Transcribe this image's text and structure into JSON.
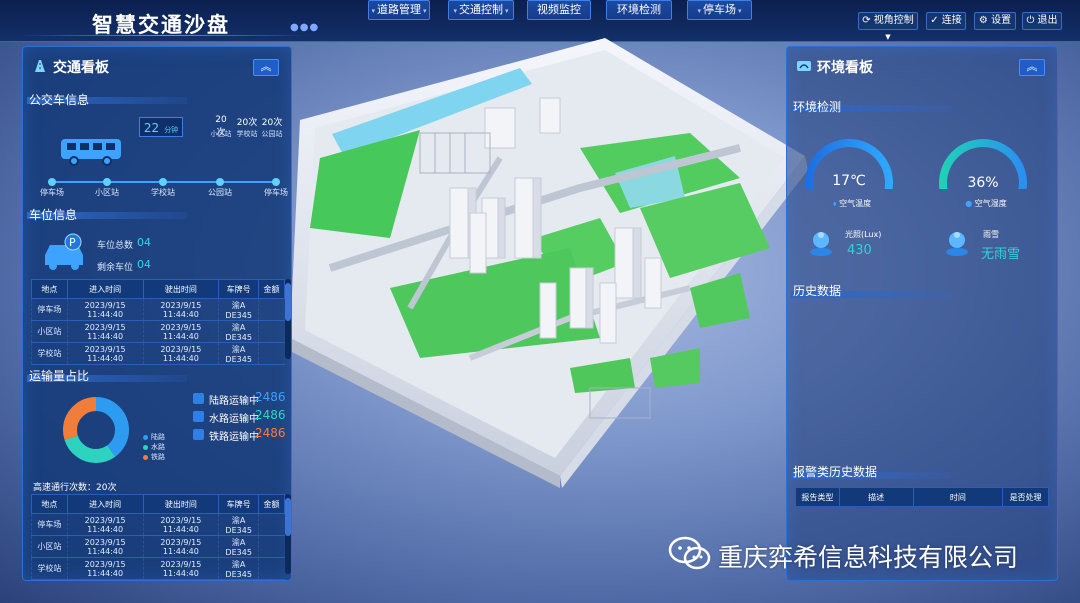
{
  "app_title": "智慧交通沙盘",
  "nav": [
    {
      "label": "道路管理",
      "dropdown": true
    },
    {
      "label": "交通控制",
      "dropdown": true
    },
    {
      "label": "视频监控",
      "dropdown": false
    },
    {
      "label": "环境检测",
      "dropdown": false
    },
    {
      "label": "停车场",
      "dropdown": true
    }
  ],
  "toolbar": {
    "view_control": "视角控制",
    "connect": "连接",
    "settings": "设置",
    "logout": "退出"
  },
  "left_panel": {
    "title": "交通看板",
    "bus": {
      "section": "公交车信息",
      "eta_value": "22",
      "eta_unit": "分钟",
      "counts": [
        {
          "value": "20次",
          "stop": "小区站"
        },
        {
          "value": "20次",
          "stop": "学校站"
        },
        {
          "value": "20次",
          "stop": "公园站"
        }
      ],
      "route": [
        "停车场",
        "小区站",
        "学校站",
        "公园站",
        "停车场"
      ]
    },
    "parking": {
      "section": "车位信息",
      "total_label": "车位总数",
      "total_value": "04",
      "remain_label": "剩余车位",
      "remain_value": "04",
      "table": {
        "headers": [
          "地点",
          "进入时间",
          "驶出时间",
          "车牌号",
          "金额"
        ],
        "rows": [
          [
            "停车场",
            "2023/9/15 11:44:40",
            "2023/9/15 11:44:40",
            "渝A DE345",
            ""
          ],
          [
            "小区站",
            "2023/9/15 11:44:40",
            "2023/9/15 11:44:40",
            "渝A DE345",
            ""
          ],
          [
            "学校站",
            "2023/9/15 11:44:40",
            "2023/9/15 11:44:40",
            "渝A DE345",
            ""
          ]
        ]
      }
    },
    "transport": {
      "section": "运输量占比",
      "legend": [
        {
          "name": "陆路",
          "color": "#2d9bf0",
          "share": 0.4
        },
        {
          "name": "水路",
          "color": "#2ed3c0",
          "share": 0.3
        },
        {
          "name": "铁路",
          "color": "#f07d3a",
          "share": 0.3
        }
      ],
      "items": [
        {
          "label": "陆路运输中",
          "value": "2486",
          "color": "#3aa0ff"
        },
        {
          "label": "水路运输中",
          "value": "2486",
          "color": "#30d6c4"
        },
        {
          "label": "铁路运输中",
          "value": "2486",
          "color": "#ff7a3a"
        }
      ],
      "highway_count": "高速通行次数：20次",
      "table": {
        "headers": [
          "地点",
          "进入时间",
          "驶出时间",
          "车牌号",
          "金额"
        ],
        "rows": [
          [
            "停车场",
            "2023/9/15 11:44:40",
            "2023/9/15 11:44:40",
            "渝A DE345",
            ""
          ],
          [
            "小区站",
            "2023/9/15 11:44:40",
            "2023/9/15 11:44:40",
            "渝A DE345",
            ""
          ],
          [
            "学校站",
            "2023/9/15 11:44:40",
            "2023/9/15 11:44:40",
            "渝A DE345",
            ""
          ]
        ]
      }
    }
  },
  "right_panel": {
    "title": "环境看板",
    "env_section": "环境检测",
    "gauges": [
      {
        "value": "17℃",
        "label": "空气温度",
        "level": 0.5
      },
      {
        "value": "36%",
        "label": "空气湿度",
        "level": 0.36
      }
    ],
    "light": {
      "label": "光照(Lux)",
      "value": "430"
    },
    "rain": {
      "label": "雨雪",
      "value": "无雨雪"
    },
    "history_section": "历史数据",
    "alarm_section": "报警类历史数据",
    "alarm_headers": [
      "报告类型",
      "描述",
      "时间",
      "是否处理"
    ]
  },
  "watermark": "重庆弈希信息科技有限公司"
}
